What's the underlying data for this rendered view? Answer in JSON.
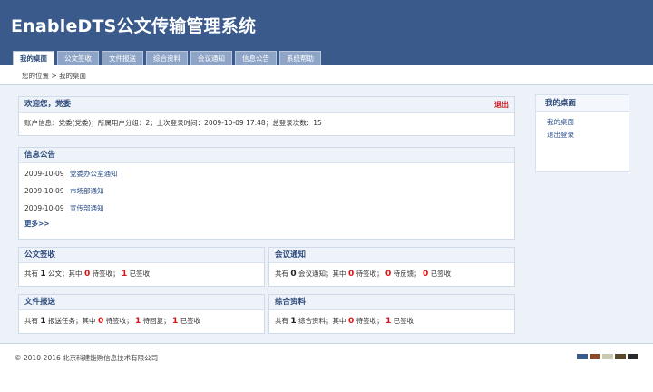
{
  "app": {
    "title": "EnableDTS公文传输管理系统"
  },
  "tabs": [
    {
      "label": "我的桌面",
      "active": true
    },
    {
      "label": "公文签收"
    },
    {
      "label": "文件报送"
    },
    {
      "label": "综合资料"
    },
    {
      "label": "会议通知"
    },
    {
      "label": "信息公告"
    },
    {
      "label": "系统帮助"
    }
  ],
  "breadcrumb": "您的位置 > 我的桌面",
  "welcome": {
    "title": "欢迎您，党委",
    "logout": "退出",
    "info": "账户信息：党委(党委)；所属用户分组：2；上次登录时间：2009-10-09 17:48；总登录次数：15"
  },
  "notices": {
    "title": "信息公告",
    "items": [
      {
        "date": "2009-10-09",
        "text": "党委办公室通知"
      },
      {
        "date": "2009-10-09",
        "text": "市场部通知"
      },
      {
        "date": "2009-10-09",
        "text": "宣传部通知"
      }
    ],
    "more": "更多>>"
  },
  "docs_receive": {
    "title": "公文签收",
    "p1": "共有",
    "total": "1",
    "p2": "公文；其中",
    "pending": "0",
    "p3": "待签收；",
    "done": "1",
    "p4": "已签收"
  },
  "meeting": {
    "title": "会议通知",
    "p1": "共有",
    "total": "0",
    "p2": "会议通知；其中",
    "pending": "0",
    "p3": "待签收；",
    "feedback": "0",
    "p4": "待反馈；",
    "done": "0",
    "p5": "已签收"
  },
  "file_submit": {
    "title": "文件报送",
    "p1": "共有",
    "total": "1",
    "p2": "报送任务；其中",
    "pending": "0",
    "p3": "待签收；",
    "reply": "1",
    "p4": "待回复；",
    "done": "1",
    "p5": "已签收"
  },
  "materials": {
    "title": "综合资料",
    "p1": "共有",
    "total": "1",
    "p2": "综合资料；其中",
    "pending": "0",
    "p3": "待签收；",
    "done": "1",
    "p4": "已签收"
  },
  "sidebar": {
    "title": "我的桌面",
    "links": [
      "我的桌面",
      "退出登录"
    ]
  },
  "footer": {
    "copyright": "© 2010-2016 北京科建能购信息技术有限公司"
  },
  "theme_swatches": [
    "#3a5a8c",
    "#8a4a2a",
    "#c9c9b0",
    "#5a4a2a",
    "#2a2a2a"
  ]
}
